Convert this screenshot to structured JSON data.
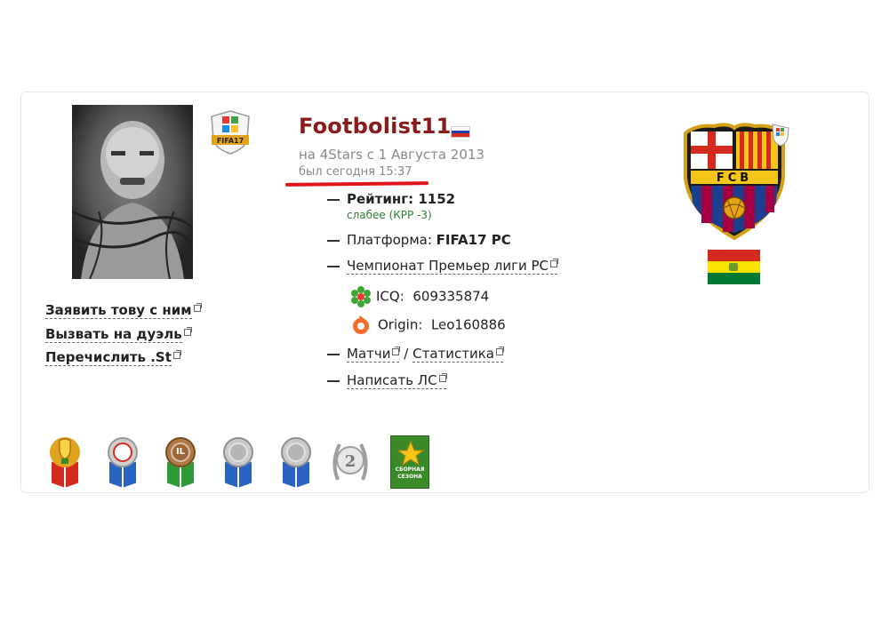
{
  "profile": {
    "username": "Footbolist11",
    "since": "на 4Stars с 1 Августа 2013",
    "last_seen": "был сегодня 15:37",
    "rating_label": "Рейтинг:",
    "rating_value": "1152",
    "rating_note": "слабее (КРР -3)",
    "platform_label": "Платформа:",
    "platform_value": "FIFA17 PC",
    "championship": "Чемпионат Премьер лиги PC",
    "icq_label": "ICQ:",
    "icq_value": "609335874",
    "origin_label": "Origin:",
    "origin_value": "Leo160886",
    "matches": "Матчи",
    "separator": "/",
    "statistics": "Статистика",
    "write_pm": "Написать ЛС"
  },
  "actions": {
    "claim": "Заявить тову с ним",
    "challenge": "Вызвать на дуэль",
    "list": "Перечислить .St"
  },
  "badges": {
    "fifa": "FIFA17",
    "crest": "FCB",
    "medal_1": "IL",
    "medal_2": "2",
    "season_card": "СБОРНАЯ СЕЗОНА"
  },
  "colors": {
    "username": "#8b1a1a",
    "accent_red": "#e0141b",
    "rating_note": "#2e7d32"
  },
  "icons": [
    "fifa17-badge-icon",
    "russia-flag-icon",
    "icq-flower-icon",
    "origin-icon",
    "external-link-icon",
    "fc-barcelona-crest-icon",
    "bolivia-flag-icon",
    "trophy-medal-icon",
    "ribbon-medal-icon",
    "laurel-medal-icon",
    "season-card-icon"
  ]
}
